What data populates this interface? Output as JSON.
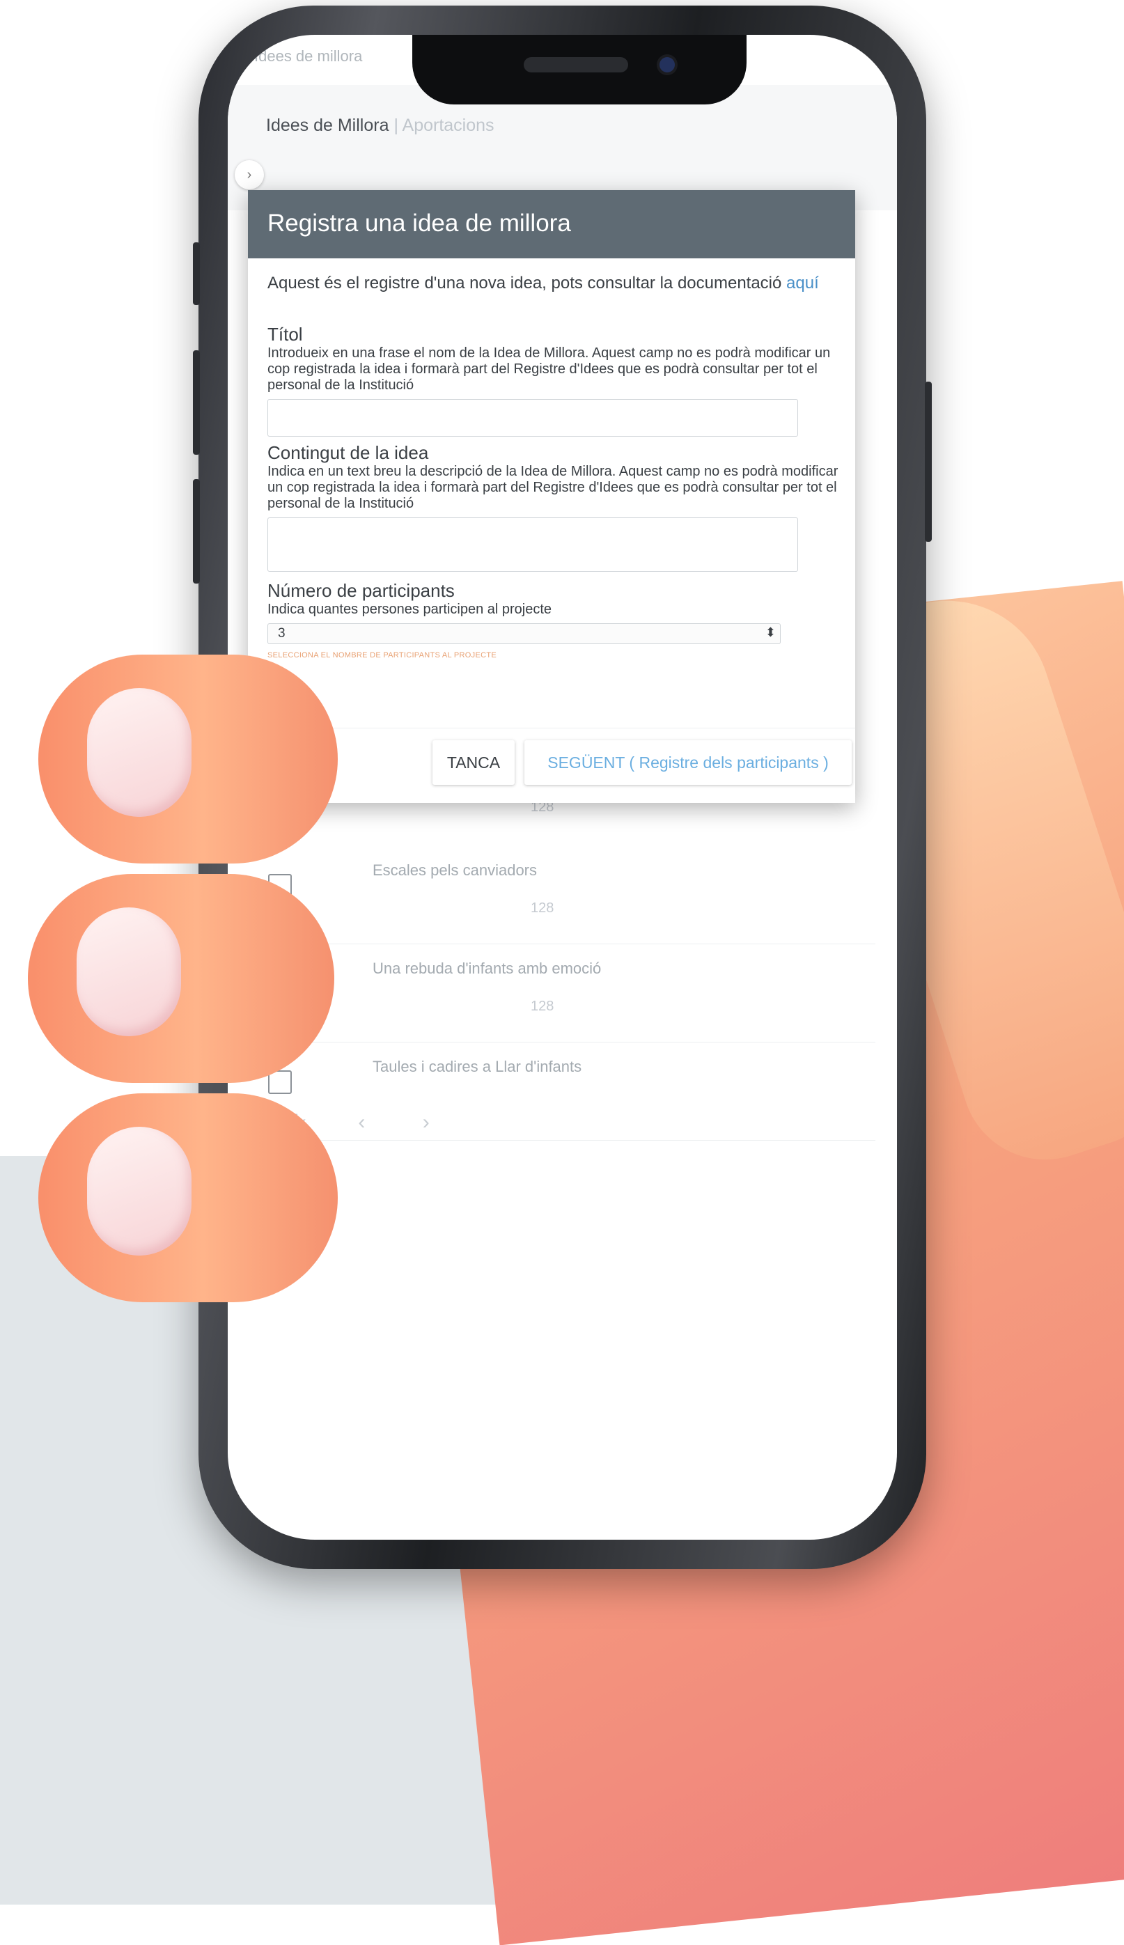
{
  "app": {
    "status_title": "Idees de millora",
    "breadcrumb": {
      "main": "Idees de Millora",
      "separator": "|",
      "sub": "Aportacions"
    },
    "side_toggle": "›"
  },
  "modal": {
    "title": "Registra una idea de millora",
    "intro": "Aquest és el registre d'una nova idea, pots consultar la documentació",
    "intro_link": "aquí",
    "fields": {
      "title": {
        "label": "Títol",
        "help": "Introdueix en una frase el nom de la Idea de Millora. Aquest camp no es podrà modificar un cop registrada la idea i formarà part del Registre d'Idees que es podrà consultar per tot el personal de la Institució",
        "value": ""
      },
      "content": {
        "label": "Contingut de la idea",
        "help": "Indica en un text breu la descripció de la Idea de Millora. Aquest camp no es podrà modificar un cop registrada la idea i formarà part del Registre d'Idees que es podrà consultar per tot el personal de la Institució",
        "value": ""
      },
      "participants": {
        "label": "Número de participants",
        "help": "Indica quantes persones participen al projecte",
        "selected": "3",
        "arrows": "⬍"
      }
    },
    "hint": "SELECCIONA EL NOMBRE DE PARTICIPANTS AL PROJECTE",
    "buttons": {
      "close": "TANCA",
      "next": "SEGÜENT ( Registre dels participants )"
    }
  },
  "list": {
    "partial_count": "128",
    "rows": [
      {
        "title": "Escales pels canviadors",
        "count": "128"
      },
      {
        "title": "Una rebuda d'infants amb emoció",
        "count": "128"
      },
      {
        "title": "Taules i cadires a Llar d'infants",
        "count": ""
      }
    ]
  },
  "pager": {
    "first": "|‹",
    "prev": "‹",
    "next": "›"
  }
}
